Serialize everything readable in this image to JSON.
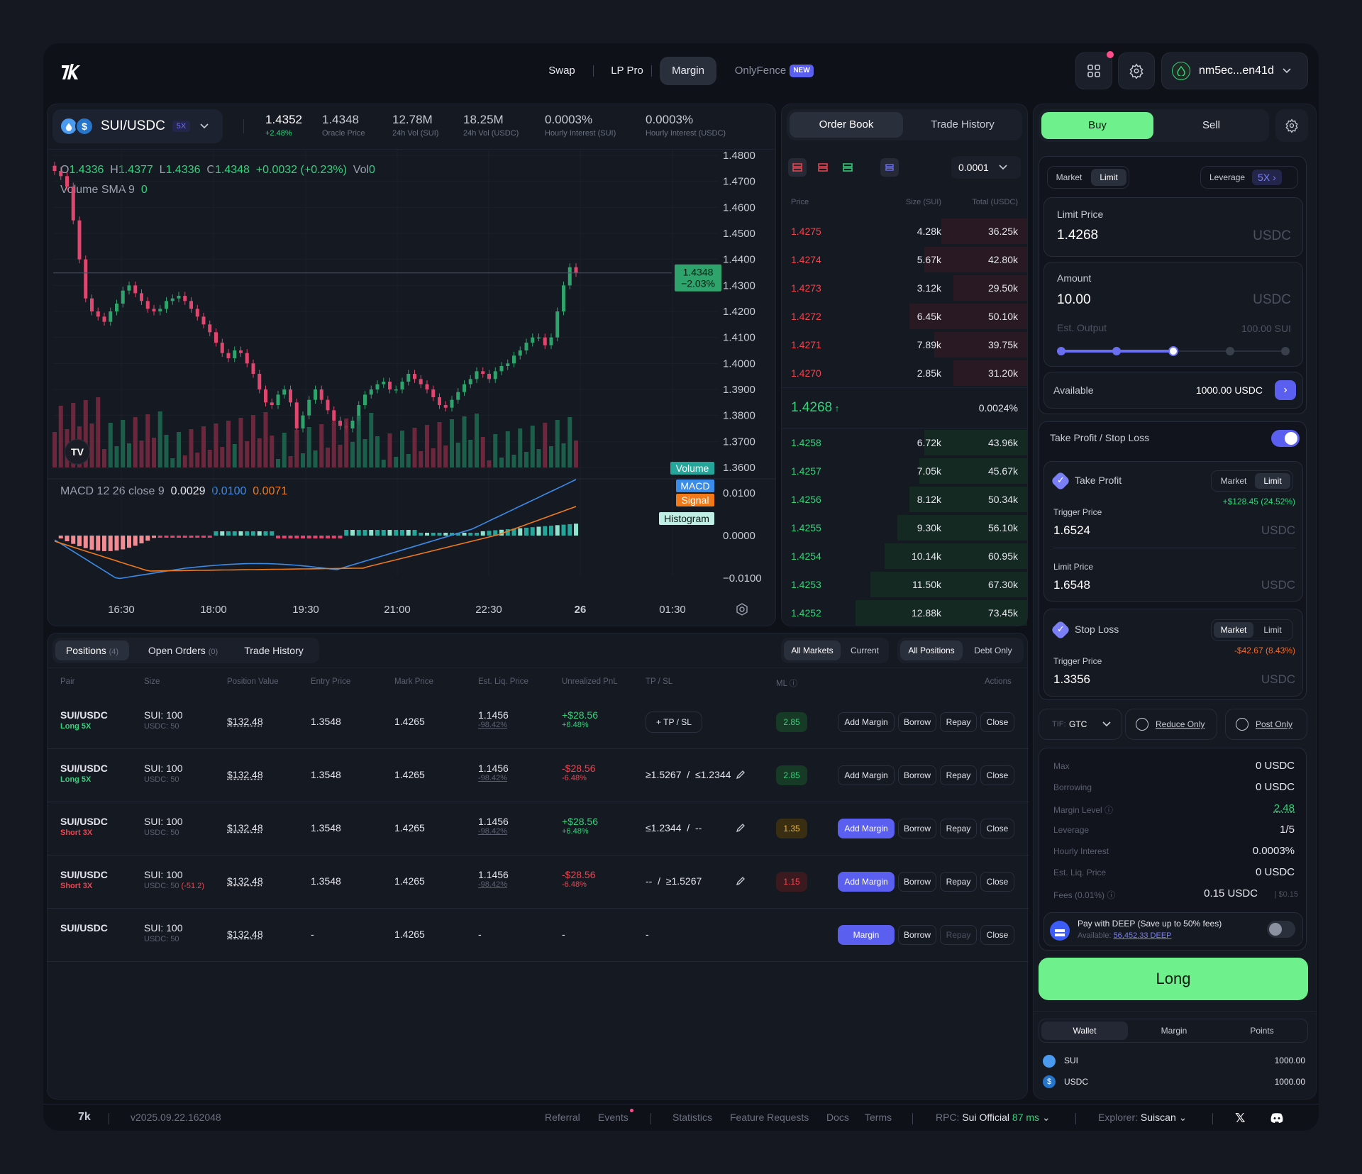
{
  "header": {
    "nav": [
      "Swap",
      "LP Pro",
      "Margin",
      "OnlyFence"
    ],
    "new_badge": "NEW",
    "wallet": "nm5ec...en41d"
  },
  "market": {
    "pair": "SUI/USDC",
    "leverage": "5X",
    "price": "1.4352",
    "change": "+2.48%",
    "stats": [
      {
        "value": "1.4348",
        "label": "Oracle Price"
      },
      {
        "value": "12.78M",
        "label": "24h Vol (SUI)"
      },
      {
        "value": "18.25M",
        "label": "24h Vol (USDC)"
      },
      {
        "value": "0.0003%",
        "label": "Hourly Interest (SUI)"
      },
      {
        "value": "0.0003%",
        "label": "Hourly Interest (USDC)"
      }
    ]
  },
  "chart": {
    "ohlc": {
      "o": "1.4336",
      "h": "1.4377",
      "l": "1.4336",
      "c": "1.4348",
      "chg": "+0.0032 (+0.23%)",
      "vol": "0"
    },
    "volume_sma": "Volume SMA 9",
    "volume_sma_val": "0",
    "price_axis": [
      "1.4800",
      "1.4700",
      "1.4600",
      "1.4500",
      "1.4400",
      "1.4300",
      "1.4200",
      "1.4100",
      "1.4000",
      "1.3900",
      "1.3800",
      "1.3700",
      "1.3600"
    ],
    "last_price": "1.4348",
    "last_change": "−2.03%",
    "tags": {
      "volume": "Volume",
      "macd": "MACD",
      "signal": "Signal",
      "histogram": "Histogram"
    },
    "macd_label": "MACD 12 26 close 9",
    "macd_vals": [
      "0.0029",
      "0.0100",
      "0.0071"
    ],
    "macd_axis": [
      "0.0100",
      "0.0000",
      "−0.0100"
    ],
    "time_axis": [
      "16:30",
      "18:00",
      "19:30",
      "21:00",
      "22:30",
      "26",
      "01:30"
    ],
    "colors": {
      "up": "#2ea36b",
      "down": "#e0466e",
      "macd": "#3b8be8",
      "signal": "#f07a1a"
    }
  },
  "orderbook": {
    "tabs": [
      "Order Book",
      "Trade History"
    ],
    "tick": "0.0001",
    "headers": [
      "Price",
      "Size (SUI)",
      "Total (USDC)"
    ],
    "asks": [
      {
        "price": "1.4275",
        "size": "4.28k",
        "total": "36.25k",
        "depth": 0.35
      },
      {
        "price": "1.4274",
        "size": "5.67k",
        "total": "42.80k",
        "depth": 0.42
      },
      {
        "price": "1.4273",
        "size": "3.12k",
        "total": "29.50k",
        "depth": 0.3
      },
      {
        "price": "1.4272",
        "size": "6.45k",
        "total": "50.10k",
        "depth": 0.48
      },
      {
        "price": "1.4271",
        "size": "7.89k",
        "total": "39.75k",
        "depth": 0.38
      },
      {
        "price": "1.4270",
        "size": "2.85k",
        "total": "31.20k",
        "depth": 0.3
      }
    ],
    "mid": "1.4268",
    "spread": "0.0024%",
    "bids": [
      {
        "price": "1.4258",
        "size": "6.72k",
        "total": "43.96k",
        "depth": 0.42
      },
      {
        "price": "1.4257",
        "size": "7.05k",
        "total": "45.67k",
        "depth": 0.44
      },
      {
        "price": "1.4256",
        "size": "8.12k",
        "total": "50.34k",
        "depth": 0.48
      },
      {
        "price": "1.4255",
        "size": "9.30k",
        "total": "56.10k",
        "depth": 0.53
      },
      {
        "price": "1.4254",
        "size": "10.14k",
        "total": "60.95k",
        "depth": 0.58
      },
      {
        "price": "1.4253",
        "size": "11.50k",
        "total": "67.30k",
        "depth": 0.64
      },
      {
        "price": "1.4252",
        "size": "12.88k",
        "total": "73.45k",
        "depth": 0.7
      }
    ]
  },
  "positions": {
    "tabs": [
      {
        "label": "Positions",
        "count": "(4)"
      },
      {
        "label": "Open Orders",
        "count": "(0)"
      },
      {
        "label": "Trade History",
        "count": ""
      }
    ],
    "filters1": [
      "All Markets",
      "Current"
    ],
    "filters2": [
      "All Positions",
      "Debt Only"
    ],
    "headers": [
      "Pair",
      "Size",
      "Position Value",
      "Entry Price",
      "Mark Price",
      "Est. Liq. Price",
      "Unrealized PnL",
      "TP / SL",
      "ML ⓘ",
      "Actions"
    ],
    "rows": [
      {
        "pair": "SUI/USDC",
        "side": "Long 5X",
        "size": "SUI: 100",
        "size2": "USDC: 50",
        "size2_extra": "",
        "value": "$132.48",
        "entry": "1.3548",
        "mark": "1.4265",
        "liq": "1.1456",
        "liq_pct": "-98.42%",
        "pnl": "+$28.56",
        "pnl_pct": "+6.48%",
        "tpsl": "+ TP / SL",
        "ml": "2.85",
        "first_btn": "Add Margin",
        "btn": [
          "Borrow",
          "Repay",
          "Close"
        ]
      },
      {
        "pair": "SUI/USDC",
        "side": "Long 5X",
        "size": "SUI: 100",
        "size2": "USDC: 50",
        "size2_extra": "",
        "value": "$132.48",
        "entry": "1.3548",
        "mark": "1.4265",
        "liq": "1.1456",
        "liq_pct": "-98.42%",
        "pnl": "-$28.56",
        "pnl_pct": "-6.48%",
        "tpsl": "≥1.5267  /  ≤1.2344",
        "ml": "2.85",
        "first_btn": "Add Margin",
        "btn": [
          "Borrow",
          "Repay",
          "Close"
        ]
      },
      {
        "pair": "SUI/USDC",
        "side": "Short 3X",
        "size": "SUI: 100",
        "size2": "USDC: 50",
        "size2_extra": "",
        "value": "$132.48",
        "entry": "1.3548",
        "mark": "1.4265",
        "liq": "1.1456",
        "liq_pct": "-98.42%",
        "pnl": "+$28.56",
        "pnl_pct": "+6.48%",
        "tpsl": "≤1.2344  /  --",
        "ml": "1.35",
        "first_btn": "Add Margin",
        "btn": [
          "Borrow",
          "Repay",
          "Close"
        ]
      },
      {
        "pair": "SUI/USDC",
        "side": "Short 3X",
        "size": "SUI: 100",
        "size2": "USDC: 50",
        "size2_extra": "(-51.2)",
        "value": "$132.48",
        "entry": "1.3548",
        "mark": "1.4265",
        "liq": "1.1456",
        "liq_pct": "-98.42%",
        "pnl": "-$28.56",
        "pnl_pct": "-6.48%",
        "tpsl": "--  /  ≥1.5267",
        "ml": "1.15",
        "first_btn": "Add Margin",
        "btn": [
          "Borrow",
          "Repay",
          "Close"
        ]
      },
      {
        "pair": "SUI/USDC",
        "side": "",
        "size": "SUI: 100",
        "size2": "USDC: 50",
        "size2_extra": "",
        "value": "$132.48",
        "entry": "-",
        "mark": "1.4265",
        "liq": "-",
        "liq_pct": "",
        "pnl": "-",
        "pnl_pct": "",
        "tpsl": "-",
        "ml": "",
        "first_btn": "Margin",
        "btn": [
          "Borrow",
          "Repay",
          "Close"
        ]
      }
    ]
  },
  "trade": {
    "sides": [
      "Buy",
      "Sell"
    ],
    "order_types": [
      "Market",
      "Limit"
    ],
    "leverage_label": "Leverage",
    "leverage": "5X",
    "limit_price_label": "Limit Price",
    "limit_price": "1.4268",
    "unit": "USDC",
    "amount_label": "Amount",
    "amount": "10.00",
    "est_output_label": "Est. Output",
    "est_output": "100.00 SUI",
    "slider_level": 0.5,
    "available_label": "Available",
    "available": "1000.00 USDC",
    "tpsl_label": "Take Profit / Stop Loss",
    "take_profit": {
      "label": "Take Profit",
      "modes": [
        "Market",
        "Limit"
      ],
      "pnl": "+$128.45 (24.52%)",
      "trigger_label": "Trigger Price",
      "trigger": "1.6524",
      "limit_label": "Limit Price",
      "limit": "1.6548"
    },
    "stop_loss": {
      "label": "Stop Loss",
      "modes": [
        "Market",
        "Limit"
      ],
      "pnl": "-$42.67 (8.43%)",
      "trigger_label": "Trigger Price",
      "trigger": "1.3356"
    },
    "tif_label": "TIF:",
    "tif": "GTC",
    "reduce_only": "Reduce Only",
    "post_only": "Post Only",
    "summary": [
      {
        "k": "Max",
        "v": "0 USDC"
      },
      {
        "k": "Borrowing",
        "v": "0 USDC"
      },
      {
        "k": "Margin Level ⓘ",
        "v": "2.48"
      },
      {
        "k": "Leverage",
        "v": "1/5"
      },
      {
        "k": "Hourly Interest",
        "v": "0.0003%"
      },
      {
        "k": "Est. Liq. Price",
        "v": "0 USDC"
      },
      {
        "k": "Fees (0.01%) ⓘ",
        "v": "0.15 USDC"
      }
    ],
    "fee_usd": "| $0.15",
    "deep_label": "Pay with DEEP (Save up to 50% fees)",
    "deep_avail_label": "Available:",
    "deep_avail": "56,452.33 DEEP",
    "submit": "Long",
    "wallet_tabs": [
      "Wallet",
      "Margin",
      "Points"
    ],
    "balances": [
      {
        "asset": "SUI",
        "amount": "1000.00"
      },
      {
        "asset": "USDC",
        "amount": "1000.00"
      }
    ]
  },
  "footer": {
    "version": "v2025.09.22.162048",
    "links": [
      "Referral",
      "Events",
      "Statistics",
      "Feature Requests",
      "Docs",
      "Terms"
    ],
    "rpc_label": "RPC:",
    "rpc": "Sui Official",
    "rpc_ms": "87 ms",
    "explorer_label": "Explorer:",
    "explorer": "Suiscan"
  }
}
